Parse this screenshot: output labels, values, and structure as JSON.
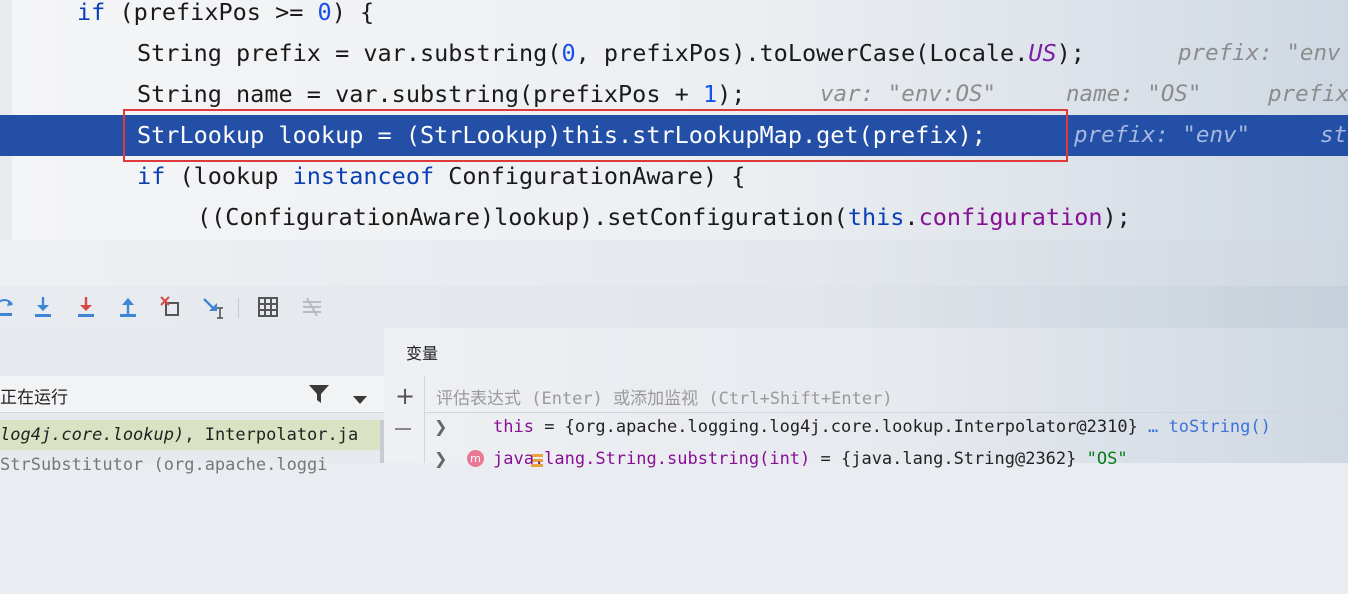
{
  "editor": {
    "lines": [
      {
        "code": [
          {
            "t": "if",
            "c": "kw"
          },
          {
            "t": " (prefixPos >= "
          },
          {
            "t": "0",
            "c": "num"
          },
          {
            "t": ") {"
          }
        ],
        "hints": []
      },
      {
        "code": [
          {
            "t": "String prefix = var.substring("
          },
          {
            "t": "0",
            "c": "num"
          },
          {
            "t": ", prefixPos).toLowerCase(Locale."
          },
          {
            "t": "US",
            "c": "cn"
          },
          {
            "t": ");"
          }
        ],
        "hints": [
          "prefix: \"env"
        ]
      },
      {
        "code": [
          {
            "t": "String name = var.substring(prefixPos + "
          },
          {
            "t": "1",
            "c": "num"
          },
          {
            "t": ");"
          }
        ],
        "hints": [
          "var: \"env:OS\"",
          "name: \"OS\"",
          "prefix"
        ]
      },
      {
        "code": [
          {
            "t": "StrLookup lookup = (StrLookup)this.strLookupMap.get(prefix);"
          }
        ],
        "hints": [
          "prefix: \"env\"",
          "st"
        ]
      },
      {
        "code": [
          {
            "t": "if",
            "c": "kw"
          },
          {
            "t": " (lookup "
          },
          {
            "t": "instanceof",
            "c": "kw"
          },
          {
            "t": " ConfigurationAware) {"
          }
        ],
        "hints": []
      },
      {
        "code": [
          {
            "t": "((ConfigurationAware)lookup).setConfiguration("
          },
          {
            "t": "this",
            "c": "kw"
          },
          {
            "t": "."
          },
          {
            "t": "configuration",
            "c": "fld"
          },
          {
            "t": ");"
          }
        ],
        "hints": []
      }
    ]
  },
  "toolbar": {
    "buttons": [
      {
        "name": "step-over-icon"
      },
      {
        "name": "step-into-icon"
      },
      {
        "name": "force-step-into-icon"
      },
      {
        "name": "step-out-icon"
      },
      {
        "name": "drop-frame-icon"
      },
      {
        "name": "run-to-cursor-icon"
      },
      {
        "name": "evaluate-expression-icon"
      },
      {
        "name": "trace-stream-icon"
      }
    ]
  },
  "frames": {
    "thread_label": "正在运行",
    "items": [
      {
        "prefix": "log4j.core.lookup)",
        "rest": ", Interpolator.ja"
      },
      {
        "prefix": "",
        "rest": "StrSubstitutor (org.apache.loggi"
      }
    ]
  },
  "variables": {
    "title": "变量",
    "eval_placeholder": "评估表达式 (Enter) 或添加监视 (Ctrl+Shift+Enter)",
    "rows": [
      {
        "name": "this",
        "value": " = {org.apache.logging.log4j.core.lookup.Interpolator@2310}",
        "link": " … toString()"
      },
      {
        "name": "java.lang.String.substring(int)",
        "value": " = {java.lang.String@2362} ",
        "str": "\"OS\""
      }
    ]
  },
  "colors": {
    "selection": "#2350a6",
    "highlight_box": "#e0393b",
    "keyword": "#0b3fb5"
  }
}
